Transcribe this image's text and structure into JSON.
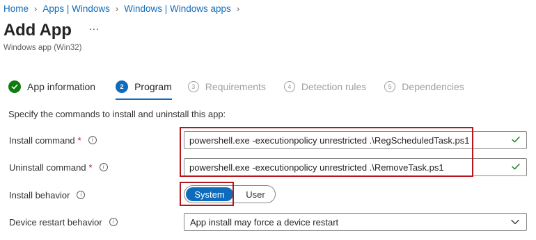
{
  "breadcrumb": {
    "items": [
      "Home",
      "Apps | Windows",
      "Windows | Windows apps"
    ]
  },
  "header": {
    "title": "Add App",
    "more_label": "···",
    "subtitle": "Windows app (Win32)"
  },
  "steps": [
    {
      "number": "1",
      "label": "App information",
      "state": "done"
    },
    {
      "number": "2",
      "label": "Program",
      "state": "active"
    },
    {
      "number": "3",
      "label": "Requirements",
      "state": "todo"
    },
    {
      "number": "4",
      "label": "Detection rules",
      "state": "todo"
    },
    {
      "number": "5",
      "label": "Dependencies",
      "state": "todo"
    }
  ],
  "form": {
    "instructions": "Specify the commands to install and uninstall this app:",
    "install_command": {
      "label": "Install command",
      "required_mark": "*",
      "value": "powershell.exe -executionpolicy unrestricted .\\RegScheduledTask.ps1"
    },
    "uninstall_command": {
      "label": "Uninstall command",
      "required_mark": "*",
      "value": "powershell.exe -executionpolicy unrestricted .\\RemoveTask.ps1"
    },
    "install_behavior": {
      "label": "Install behavior",
      "options": [
        "System",
        "User"
      ],
      "selected": "System"
    },
    "device_restart": {
      "label": "Device restart behavior",
      "selected": "App install may force a device restart"
    },
    "info_glyph": "i"
  },
  "colors": {
    "accent": "#0f6cbd",
    "success": "#107c10",
    "required": "#a4262c",
    "highlight": "#b4161b"
  },
  "icons": {
    "breadcrumb_separator": "chevron-right-icon",
    "step_done": "checkmark-circle-icon",
    "valid": "checkmark-icon",
    "info": "info-icon",
    "dropdown": "chevron-down-icon"
  }
}
